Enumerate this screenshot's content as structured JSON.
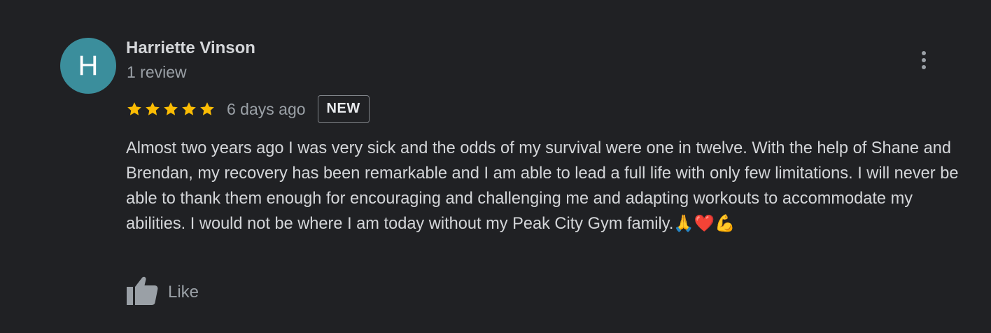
{
  "reviewer": {
    "initial": "H",
    "avatar_color": "#3b8e9c",
    "name": "Harriette Vinson",
    "review_count": "1 review"
  },
  "review": {
    "rating": 5,
    "rating_max": 5,
    "star_color": "#fbbc04",
    "time_ago": "6 days ago",
    "badge": "NEW",
    "text": "Almost two years ago I was very sick and the odds of my survival were one in twelve. With the help of Shane and Brendan, my recovery has been remarkable and I am able to lead a full life with only few limitations. I will never be able to thank them enough for encouraging and challenging me and adapting workouts to accommodate my abilities. I would not be where I am today without my Peak City Gym family.🙏❤️💪"
  },
  "actions": {
    "like_label": "Like",
    "more_icon": "more-vert-icon",
    "like_icon": "thumbs-up-icon"
  }
}
